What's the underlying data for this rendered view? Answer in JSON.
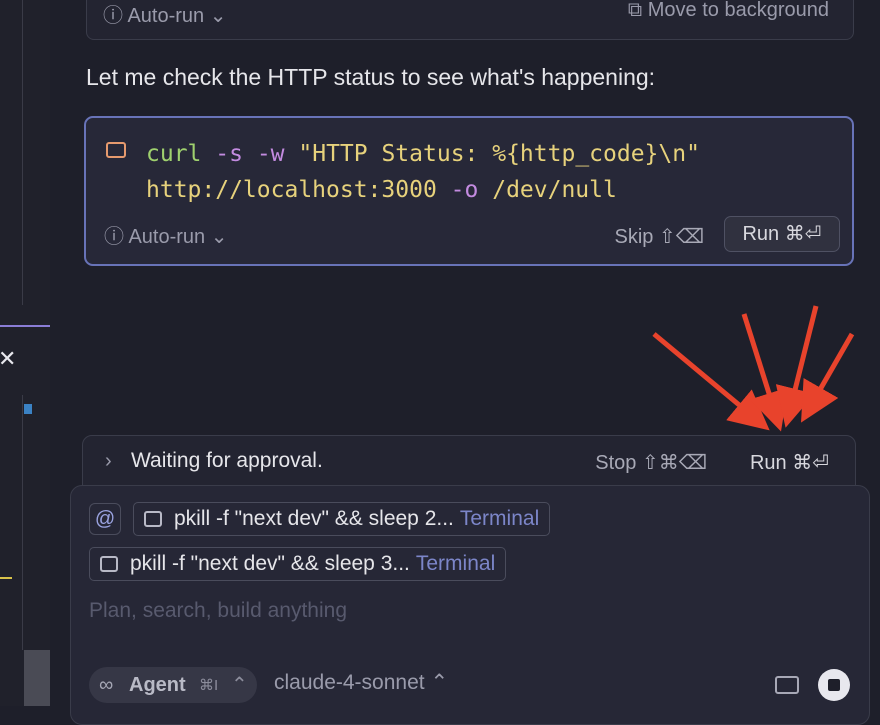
{
  "top_card": {
    "autorun_label": "Auto-run",
    "autorun_caret": "⌄",
    "move_background_label": "Move to background"
  },
  "message": "Let me check the HTTP status to see what's happening:",
  "command_card": {
    "code_line1": {
      "cmd": "curl",
      "flag1": "-s",
      "flag2": "-w",
      "str": "\"HTTP Status: %{http_code}\\n\""
    },
    "code_line2": {
      "url": "http://localhost:3000",
      "flag3": "-o",
      "path": "/dev/null"
    },
    "autorun_label": "Auto-run",
    "skip_label": "Skip ⇧⌫",
    "run_label": "Run ⌘⏎"
  },
  "approval_bar": {
    "label": "Waiting for approval.",
    "stop_label": "Stop ⇧⌘⌫",
    "run_label": "Run ⌘⏎"
  },
  "composer": {
    "at_symbol": "@",
    "context_chips": [
      {
        "text": "pkill -f \"next dev\" && sleep 2...",
        "tag": "Terminal"
      },
      {
        "text": "pkill -f \"next dev\" && sleep 3...",
        "tag": "Terminal"
      }
    ],
    "placeholder": "Plan, search, build anything",
    "agent_label": "Agent",
    "agent_shortcut": "⌘I",
    "agent_icon": "∞",
    "model": "claude-4-sonnet"
  },
  "accent_colors": {
    "annotation_arrows": "#e8432c",
    "focus_border": "#6873b8"
  }
}
